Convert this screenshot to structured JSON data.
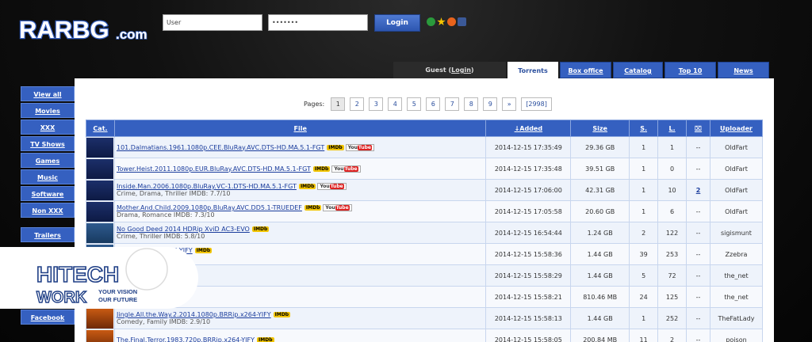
{
  "logo": {
    "text": "RARBG",
    "suffix": ".com"
  },
  "login": {
    "user_value": "User",
    "pass_value": "•••••••",
    "button": "Login"
  },
  "tabs": {
    "guest_prefix": "Guest (",
    "guest_link": "Login",
    "guest_suffix": ")",
    "items": [
      "Torrents",
      "Box office",
      "Catalog",
      "Top 10",
      "News"
    ]
  },
  "sidebar": [
    "View all",
    "Movies",
    "XXX",
    "TV Shows",
    "Games",
    "Music",
    "Software",
    "Non XXX",
    "Trailers",
    "Facebook"
  ],
  "pager": {
    "label": "Pages:",
    "pages": [
      "1",
      "2",
      "3",
      "4",
      "5",
      "6",
      "7",
      "8",
      "9",
      "»",
      "[2998]"
    ]
  },
  "table": {
    "headers": {
      "cat": "Cat.",
      "file": "File",
      "added": "↓Added",
      "size": "Size",
      "s": "S.",
      "l": "L.",
      "c": "⌧",
      "uploader": "Uploader"
    },
    "imdb_badge": "IMDb",
    "yt_prefix": "You",
    "yt_badge": "Tube",
    "rows": [
      {
        "file": "101.Dalmatians.1961.1080p.CEE.BluRay.AVC.DTS-HD.MA.5.1-FGT",
        "sub": "",
        "added": "2014-12-15 17:35:49",
        "size": "29.36 GB",
        "s": "1",
        "l": "1",
        "c": "--",
        "uploader": "OldFart",
        "cat": "bluray",
        "yt": true
      },
      {
        "file": "Tower.Heist.2011.1080p.EUR.BluRay.AVC.DTS-HD.MA.5.1-FGT",
        "sub": "",
        "added": "2014-12-15 17:35:48",
        "size": "39.51 GB",
        "s": "1",
        "l": "0",
        "c": "--",
        "uploader": "OldFart",
        "cat": "bluray",
        "yt": true
      },
      {
        "file": "Inside.Man.2006.1080p.BluRay.VC-1.DTS-HD.MA.5.1-FGT",
        "sub": "Crime, Drama, Thriller IMDB: 7.7/10",
        "added": "2014-12-15 17:06:00",
        "size": "42.31 GB",
        "s": "1",
        "l": "10",
        "c": "2",
        "uploader": "OldFart",
        "cat": "bluray",
        "yt": true
      },
      {
        "file": "Mother.And.Child.2009.1080p.BluRay.AVC.DD5.1-TRUEDEF",
        "sub": "Drama, Romance IMDB: 7.3/10",
        "added": "2014-12-15 17:05:58",
        "size": "20.60 GB",
        "s": "1",
        "l": "6",
        "c": "--",
        "uploader": "OldFart",
        "cat": "bluray",
        "yt": true
      },
      {
        "file": "No Good Deed 2014 HDRip XviD AC3-EVO",
        "sub": "Crime, Thriller IMDB: 5.8/10",
        "added": "2014-12-15 16:54:44",
        "size": "1.24 GB",
        "s": "2",
        "l": "122",
        "c": "--",
        "uploader": "sigismunt",
        "cat": "xvid",
        "yt": false
      },
      {
        "file": ".1080p.BRRip.x264-YIFY",
        "sub": "IDB: 5.5/10",
        "added": "2014-12-15 15:58:36",
        "size": "1.44 GB",
        "s": "39",
        "l": "253",
        "c": "--",
        "uploader": "Zzebra",
        "cat": "xvid",
        "yt": false
      },
      {
        "file": "x264-YIFY",
        "sub": "",
        "added": "2014-12-15 15:58:29",
        "size": "1.44 GB",
        "s": "5",
        "l": "72",
        "c": "--",
        "uploader": "the_net",
        "cat": "xvid",
        "yt": false
      },
      {
        "file": "BRRip.x264-YIFY",
        "sub": "7/10",
        "added": "2014-12-15 15:58:21",
        "size": "810.46 MB",
        "s": "24",
        "l": "125",
        "c": "--",
        "uploader": "the_net",
        "cat": "xvid",
        "yt": false
      },
      {
        "file": "Jingle.All.the.Way.2.2014.1080p.BRRip.x264-YIFY",
        "sub": "Comedy, Family IMDB: 2.9/10",
        "added": "2014-12-15 15:58:13",
        "size": "1.44 GB",
        "s": "1",
        "l": "252",
        "c": "--",
        "uploader": "TheFatLady",
        "cat": "dvd",
        "yt": false
      },
      {
        "file": "The.Final.Terror.1983.720p.BRRip.x264-YIFY",
        "sub": "",
        "added": "2014-12-15 15:58:05",
        "size": "200.84 MB",
        "s": "11",
        "l": "2",
        "c": "--",
        "uploader": "poison",
        "cat": "dvd",
        "yt": false
      }
    ]
  },
  "watermark": {
    "brand_top": "HITECH",
    "brand_bottom": "WORK",
    "tagline_1": "YOUR VISION",
    "tagline_2": "OUR FUTURE"
  },
  "colors": {
    "accent": "#3560c0",
    "link": "#1a3c9c",
    "seed_red": "#dd3333",
    "seed_green": "#2a8a2a"
  }
}
